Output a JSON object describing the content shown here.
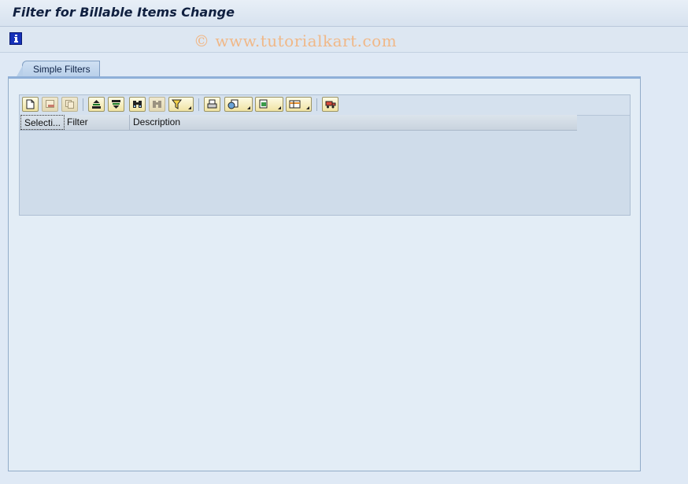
{
  "window": {
    "title": "Filter for Billable Items Change"
  },
  "appbar": {
    "info_icon": "info-icon"
  },
  "watermark": {
    "text": "© www.tutorialkart.com"
  },
  "tabs": [
    {
      "label": "Simple Filters",
      "active": true
    }
  ],
  "toolbar": {
    "buttons": [
      {
        "name": "new-icon",
        "enabled": true
      },
      {
        "name": "delete-row-icon",
        "enabled": false
      },
      {
        "name": "copy-icon",
        "enabled": false
      },
      {
        "name": "sort-ascending-icon",
        "enabled": true
      },
      {
        "name": "sort-descending-icon",
        "enabled": true
      },
      {
        "name": "find-icon",
        "enabled": true
      },
      {
        "name": "find-next-icon",
        "enabled": false
      },
      {
        "name": "filter-icon",
        "enabled": true,
        "dropdown": true
      },
      {
        "name": "print-icon",
        "enabled": true
      },
      {
        "name": "views-icon",
        "enabled": true,
        "dropdown": true
      },
      {
        "name": "export-icon",
        "enabled": true,
        "dropdown": true
      },
      {
        "name": "layout-icon",
        "enabled": true,
        "dropdown": true
      },
      {
        "name": "details-icon",
        "enabled": true
      }
    ]
  },
  "table": {
    "columns": [
      "Selecti...",
      "Filter",
      "Description"
    ],
    "rows": []
  },
  "colors": {
    "background": "#dfe9f5",
    "toolbar_button": "#f0e3a3",
    "title": "#102040"
  }
}
